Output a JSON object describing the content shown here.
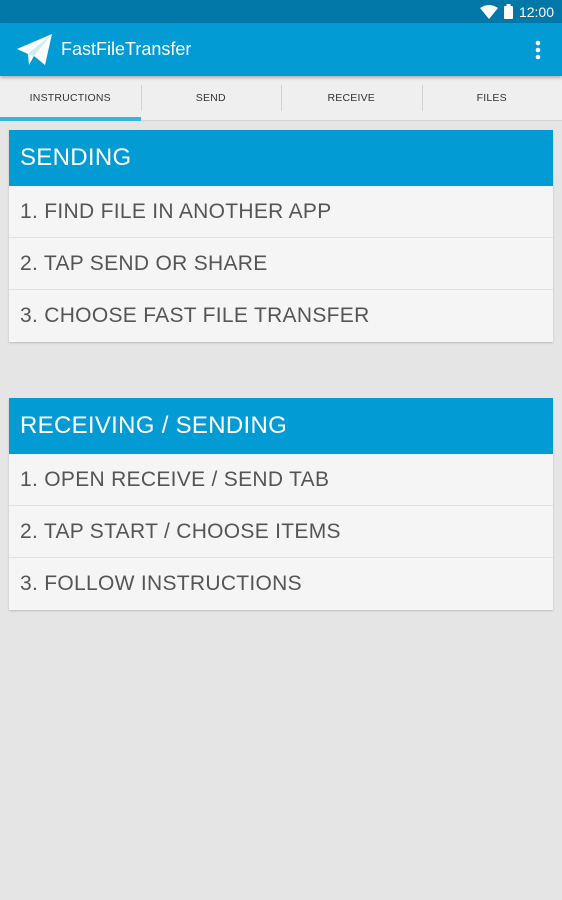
{
  "status_bar": {
    "time": "12:00",
    "icons": [
      "wifi-icon",
      "battery-icon"
    ]
  },
  "app_bar": {
    "title": "FastFileTransfer",
    "logo_icon": "paper-plane-icon",
    "menu_icon": "overflow-menu-icon"
  },
  "tabs": [
    {
      "label": "INSTRUCTIONS",
      "active": true
    },
    {
      "label": "SEND",
      "active": false
    },
    {
      "label": "RECEIVE",
      "active": false
    },
    {
      "label": "FILES",
      "active": false
    }
  ],
  "sections": [
    {
      "title": "SENDING",
      "steps": [
        "1. FIND FILE IN ANOTHER APP",
        "2. TAP SEND OR SHARE",
        "3. CHOOSE FAST FILE TRANSFER"
      ]
    },
    {
      "title": "RECEIVING / SENDING",
      "steps": [
        "1. OPEN RECEIVE / SEND TAB",
        "2. TAP START / CHOOSE ITEMS",
        "3. FOLLOW INSTRUCTIONS"
      ]
    }
  ],
  "colors": {
    "status_bar": "#0278a9",
    "primary": "#039bd4",
    "tab_indicator": "#33b5e5",
    "background": "#e5e5e5"
  }
}
